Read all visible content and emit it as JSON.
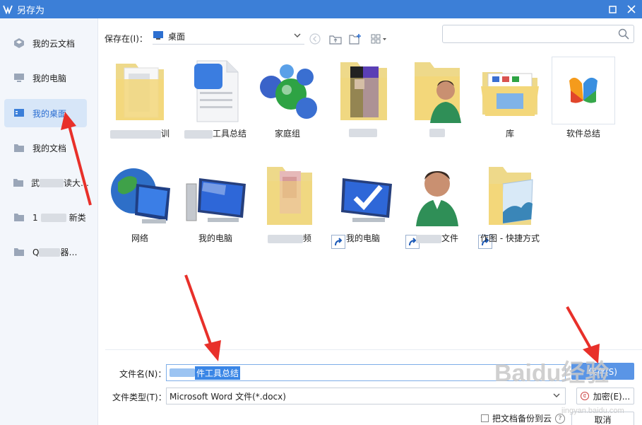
{
  "window": {
    "title": "另存为"
  },
  "sidebar": {
    "items": [
      {
        "label": "我的云文档",
        "icon": "cloud-doc-icon"
      },
      {
        "label": "我的电脑",
        "icon": "computer-icon"
      },
      {
        "label": "我的桌面",
        "icon": "desktop-icon",
        "active": true
      },
      {
        "label": "我的文档",
        "icon": "folder-icon"
      },
      {
        "label_prefix": "武",
        "label_suffix": "读大…",
        "icon": "folder-icon"
      },
      {
        "label_prefix": "1",
        "label_suffix": "新类",
        "icon": "folder-icon"
      },
      {
        "label_prefix": "Q",
        "label_suffix": "器…",
        "icon": "folder-icon"
      }
    ]
  },
  "toolbar": {
    "save_in_label": "保存在(I)：",
    "location": "桌面",
    "search_placeholder": ""
  },
  "files": [
    {
      "name": "训",
      "kind": "folder-doc",
      "blurred": true
    },
    {
      "name": "工具总结",
      "kind": "word-doc",
      "blurred": true
    },
    {
      "name": "家庭组",
      "kind": "homegroup"
    },
    {
      "name": "",
      "kind": "folder-pic",
      "blurred": true
    },
    {
      "name": "",
      "kind": "user-folder",
      "blurred": true
    },
    {
      "name": "库",
      "kind": "library"
    },
    {
      "name": "软件总结",
      "kind": "office-file"
    },
    {
      "name": "网络",
      "kind": "network"
    },
    {
      "name": "我的电脑",
      "kind": "computer"
    },
    {
      "name": "频",
      "kind": "folder-pic",
      "blurred": true
    },
    {
      "name": "我的电脑",
      "kind": "computer-check",
      "shortcut": true
    },
    {
      "name": "文件",
      "kind": "user",
      "shortcut": true,
      "blurred": true
    },
    {
      "name": "作图 - 快捷方式",
      "kind": "picture-folder",
      "shortcut": true
    }
  ],
  "form": {
    "filename_label": "文件名(N)：",
    "filename_value": "件工具总结",
    "filetype_label": "文件类型(T)：",
    "filetype_value": "Microsoft Word 文件(*.docx)",
    "save_button": "保存(S)",
    "encrypt_button": "加密(E)...",
    "cancel_button": "取消",
    "backup_checkbox": "把文档备份到云"
  },
  "watermark": {
    "brand": "Baidu经验",
    "url": "jingyan.baidu.com"
  },
  "colors": {
    "titlebar": "#3c7fd7",
    "accent": "#2a6dd1",
    "arrow": "#e8302a"
  }
}
